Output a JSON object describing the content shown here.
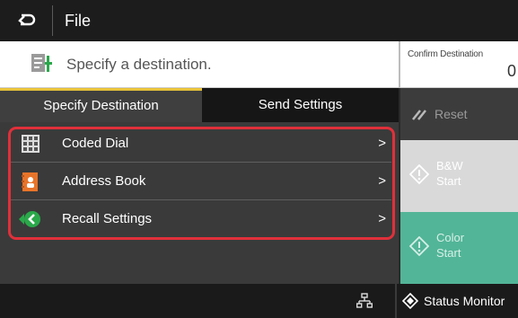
{
  "header": {
    "title": "File",
    "back_icon": "back-arrow-icon"
  },
  "destination": {
    "prompt": "Specify a destination.",
    "icon": "document-destination-icon",
    "confirm_label": "Confirm Destination",
    "confirm_count": "0"
  },
  "tabs": [
    {
      "label": "Specify Destination",
      "active": true
    },
    {
      "label": "Send Settings",
      "active": false
    }
  ],
  "menu_items": [
    {
      "label": "Coded Dial",
      "icon": "coded-dial-icon"
    },
    {
      "label": "Address Book",
      "icon": "address-book-icon"
    },
    {
      "label": "Recall Settings",
      "icon": "recall-settings-icon"
    }
  ],
  "chevron": ">",
  "side_buttons": {
    "reset": {
      "label": "Reset",
      "icon": "reset-icon"
    },
    "bw_start": {
      "line1": "B&W",
      "line2": "Start",
      "icon": "start-diamond-icon",
      "enabled": false
    },
    "color_start": {
      "line1": "Color",
      "line2": "Start",
      "icon": "start-diamond-icon",
      "enabled": false
    }
  },
  "status_bar": {
    "network_icon": "network-icon",
    "status_monitor_label": "Status Monitor",
    "status_monitor_icon": "status-monitor-icon"
  },
  "colors": {
    "tab_accent": "#e8c23a",
    "highlight": "#e0303a",
    "color_start": "#52b597",
    "bw_start": "#d9d9d9"
  }
}
